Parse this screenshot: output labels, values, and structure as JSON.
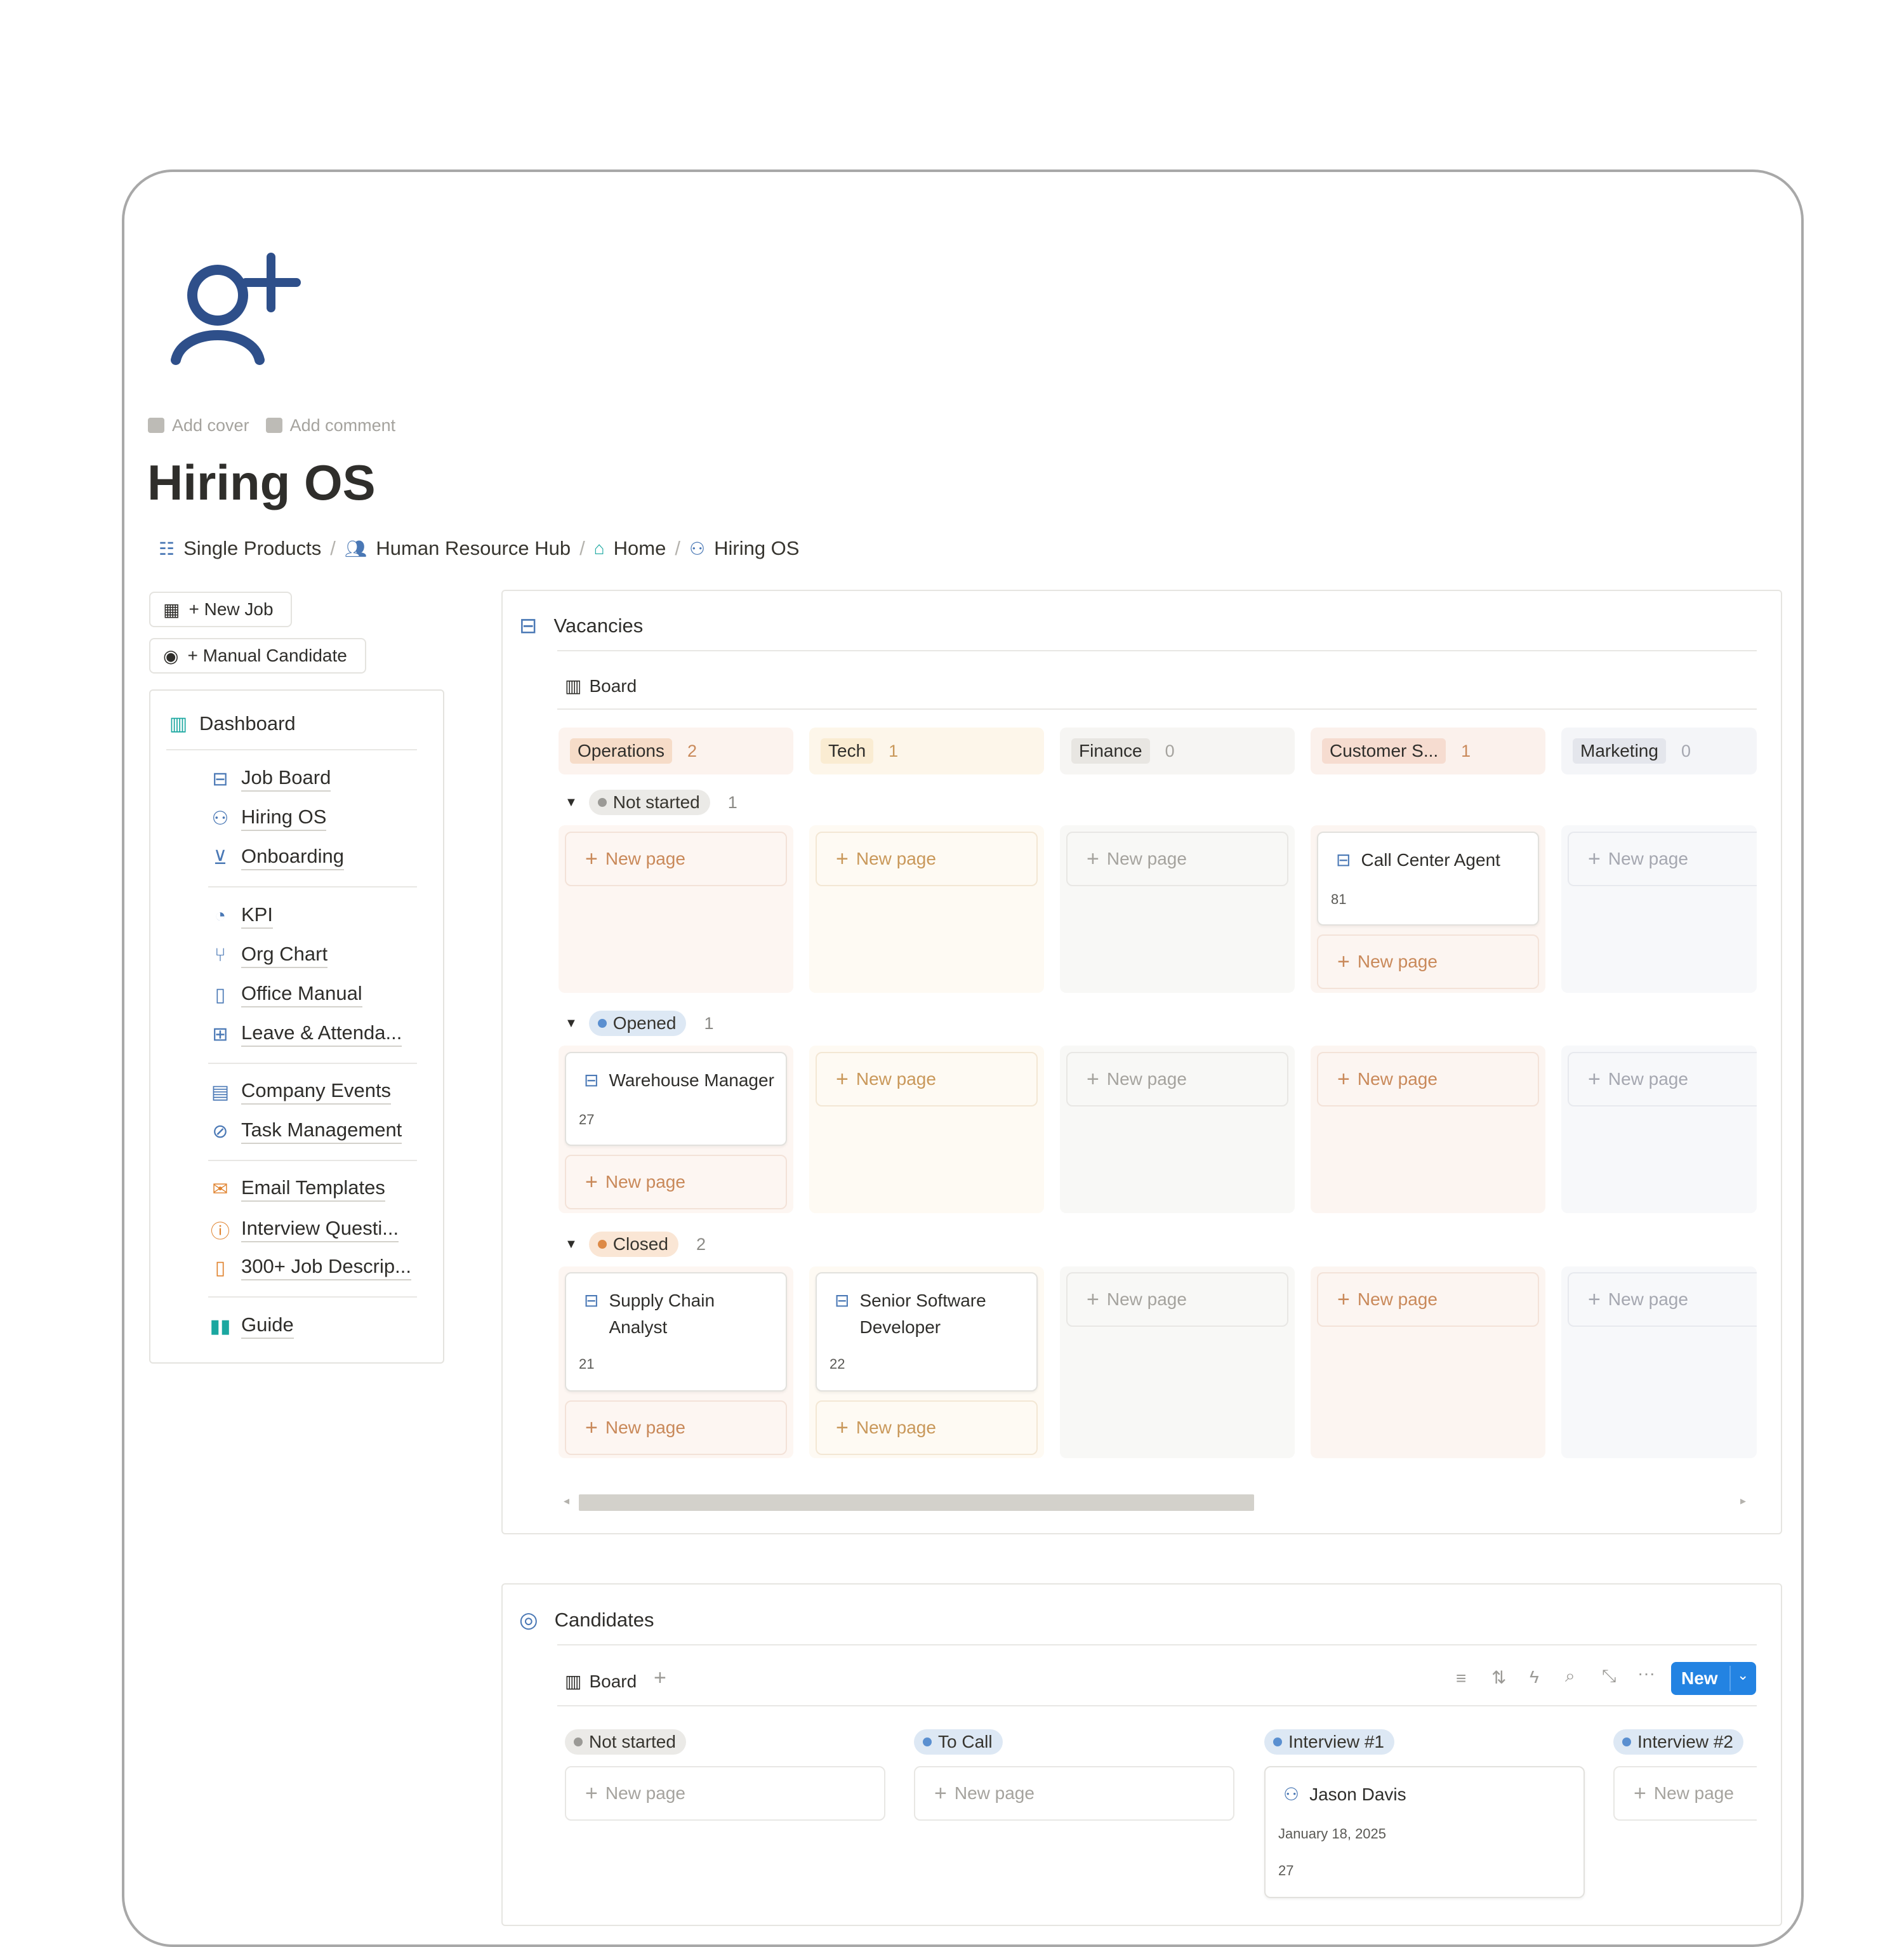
{
  "page": {
    "icon": "person-plus-icon",
    "add_cover": "Add cover",
    "add_comment": "Add comment",
    "title": "Hiring OS"
  },
  "breadcrumb": [
    {
      "label": "Single Products",
      "icon": "database-icon"
    },
    {
      "label": "Human Resource Hub",
      "icon": "people-icon"
    },
    {
      "label": "Home",
      "icon": "home-icon"
    },
    {
      "label": "Hiring OS",
      "icon": "person-plus-icon"
    }
  ],
  "buttons": {
    "new_job": "+ New Job",
    "manual_candidate": "+ Manual Candidate"
  },
  "sidebar": {
    "header": "Dashboard",
    "items": [
      {
        "label": "Job Board",
        "icon": "briefcase-icon"
      },
      {
        "label": "Hiring OS",
        "icon": "person-plus-icon"
      },
      {
        "label": "Onboarding",
        "icon": "download-icon"
      },
      {
        "label": "KPI",
        "icon": "gauge-icon"
      },
      {
        "label": "Org Chart",
        "icon": "branch-icon"
      },
      {
        "label": "Office Manual",
        "icon": "book-icon"
      },
      {
        "label": "Leave & Attenda...",
        "icon": "calendar-icon"
      },
      {
        "label": "Company Events",
        "icon": "calendar-icon"
      },
      {
        "label": "Task Management",
        "icon": "check-circle-icon"
      },
      {
        "label": "Email Templates",
        "icon": "envelope-icon"
      },
      {
        "label": "Interview Questi...",
        "icon": "question-icon"
      },
      {
        "label": "300+ Job Descrip...",
        "icon": "book-icon"
      },
      {
        "label": "Guide",
        "icon": "book-open-icon"
      }
    ]
  },
  "vacancies": {
    "title": "Vacancies",
    "view": "Board",
    "new_page": "New page",
    "columns": [
      {
        "label": "Operations",
        "count": "2"
      },
      {
        "label": "Tech",
        "count": "1"
      },
      {
        "label": "Finance",
        "count": "0"
      },
      {
        "label": "Customer S...",
        "count": "1"
      },
      {
        "label": "Marketing",
        "count": "0"
      }
    ],
    "groups": [
      {
        "label": "Not started",
        "count": "1"
      },
      {
        "label": "Opened",
        "count": "1"
      },
      {
        "label": "Closed",
        "count": "2"
      }
    ],
    "cards": [
      {
        "title": "Call Center Agent",
        "number": "81"
      },
      {
        "title": "Warehouse Manager",
        "number": "27"
      },
      {
        "title_line1": "Supply Chain",
        "title_line2": "Analyst",
        "number": "21"
      },
      {
        "title_line1": "Senior Software",
        "title_line2": "Developer",
        "number": "22"
      }
    ]
  },
  "candidates": {
    "title": "Candidates",
    "view": "Board",
    "new_button": "New",
    "new_page": "New page",
    "columns": [
      {
        "label": "Not started"
      },
      {
        "label": "To Call"
      },
      {
        "label": "Interview #1"
      },
      {
        "label": "Interview #2"
      }
    ],
    "card": {
      "name": "Jason Davis",
      "date": "January 18, 2025",
      "number": "27"
    }
  },
  "colors": {
    "accent_blue": "#2383e2",
    "icon_blue": "#4a78b5",
    "operations": "#f6dcc8",
    "tech": "#faecd2",
    "finance": "#e8e6e2",
    "customer": "#f6dcd0",
    "marketing": "#e4e6ec"
  }
}
